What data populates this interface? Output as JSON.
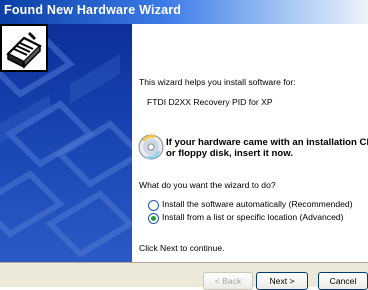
{
  "window": {
    "title": "Found New Hardware Wizard"
  },
  "intro": {
    "line1": "This wizard helps you install software for:",
    "device": "FTDI D2XX Recovery PID for XP"
  },
  "cd_notice": {
    "line1": "If your hardware came with an installation CD",
    "line2": "or floppy disk, insert it now."
  },
  "question": "What do you want the wizard to do?",
  "options": [
    {
      "label": "Install the software automatically (Recommended)",
      "selected": false
    },
    {
      "label": "Install from a list or specific location (Advanced)",
      "selected": true
    }
  ],
  "continue_text": "Click Next to continue.",
  "buttons": {
    "back": "< Back",
    "next": "Next >",
    "cancel": "Cancel"
  },
  "colors": {
    "title_bar": "#0a3fa6",
    "panel": "#1c48b6",
    "radio_dot": "#24a02c"
  }
}
